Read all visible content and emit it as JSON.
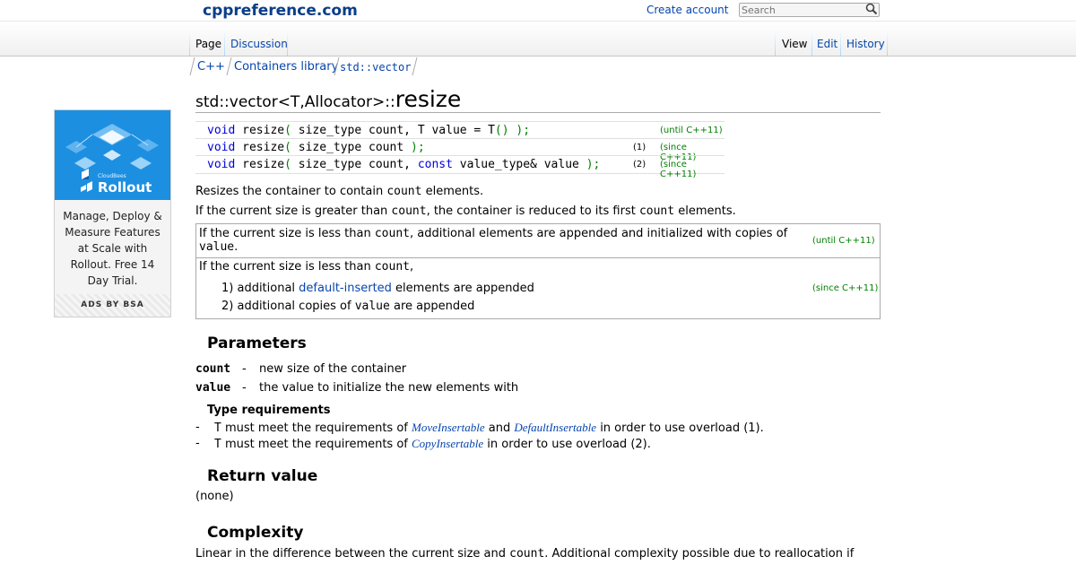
{
  "header": {
    "site_name": "cppreference.com",
    "create_account": "Create account",
    "search_placeholder": "Search"
  },
  "tabs": {
    "left": [
      {
        "label": "Page",
        "active": true
      },
      {
        "label": "Discussion",
        "active": false
      }
    ],
    "right": [
      {
        "label": "View",
        "active": true
      },
      {
        "label": "Edit",
        "active": false
      },
      {
        "label": "History",
        "active": false
      }
    ]
  },
  "breadcrumb": [
    "C++",
    "Containers library",
    "std::vector"
  ],
  "ad": {
    "brand": "Rollout",
    "brand_small": "CloudBees",
    "text": "Manage, Deploy & Measure Features at Scale with Rollout. Free 14 Day Trial.",
    "by": "ADS BY BSA",
    "color": "#1d8fe1"
  },
  "title": {
    "prefix": "std::vector<T,Allocator>::",
    "name": "resize"
  },
  "declarations": [
    {
      "void": "void",
      "pre": " resize",
      "open": "(",
      "args": " size_type count, T value = T",
      "call": "()",
      "close": " );",
      "num": "",
      "version": "(until C++11)"
    },
    {
      "void": "void",
      "pre": " resize",
      "open": "(",
      "args": " size_type count ",
      "call": "",
      "close": ");",
      "num": "(1)",
      "version": "(since C++11)"
    },
    {
      "void": "void",
      "pre": " resize",
      "open": "(",
      "args": " size_type count, ",
      "const": "const",
      "args2": " value_type& value ",
      "close": ");",
      "num": "(2)",
      "version": "(since C++11)"
    }
  ],
  "description": {
    "line1_a": "Resizes the container to contain ",
    "line1_code": "count",
    "line1_b": " elements.",
    "line2_a": "If the current size is greater than ",
    "line2_code": "count",
    "line2_b": ", the container is reduced to its first ",
    "line2_code2": "count",
    "line2_c": " elements."
  },
  "revbox": {
    "until_a": "If the current size is less than ",
    "until_code": "count",
    "until_b": ", additional elements are appended and initialized with copies of",
    "until_code2": "value",
    "until_c": ".",
    "until_ver": "(until C++11)",
    "since_a": "If the current size is less than ",
    "since_code": "count",
    "since_b": ",",
    "item1_a": "1) additional ",
    "item1_link": "default-inserted",
    "item1_b": " elements are appended",
    "item2_a": "2) additional copies of ",
    "item2_code": "value",
    "item2_b": " are appended",
    "since_ver": "(since C++11)"
  },
  "parameters": {
    "heading": "Parameters",
    "items": [
      {
        "name": "count",
        "dash": "-",
        "desc": "new size of the container"
      },
      {
        "name": "value",
        "dash": "-",
        "desc": "the value to initialize the new elements with"
      }
    ],
    "type_req_heading": "Type requirements",
    "req1": {
      "dash": "-",
      "t": "T",
      "a": " must meet the requirements of ",
      "link1": "MoveInsertable",
      "and": " and ",
      "link2": "DefaultInsertable",
      "b": " in order to use overload (1)."
    },
    "req2": {
      "dash": "-",
      "t": "T",
      "a": " must meet the requirements of ",
      "link1": "CopyInsertable",
      "b": " in order to use overload (2)."
    }
  },
  "return_value": {
    "heading": "Return value",
    "text": "(none)"
  },
  "complexity": {
    "heading": "Complexity",
    "text_a": "Linear in the difference between the current size and ",
    "text_code": "count",
    "text_b": ". Additional complexity possible due to reallocation if"
  }
}
